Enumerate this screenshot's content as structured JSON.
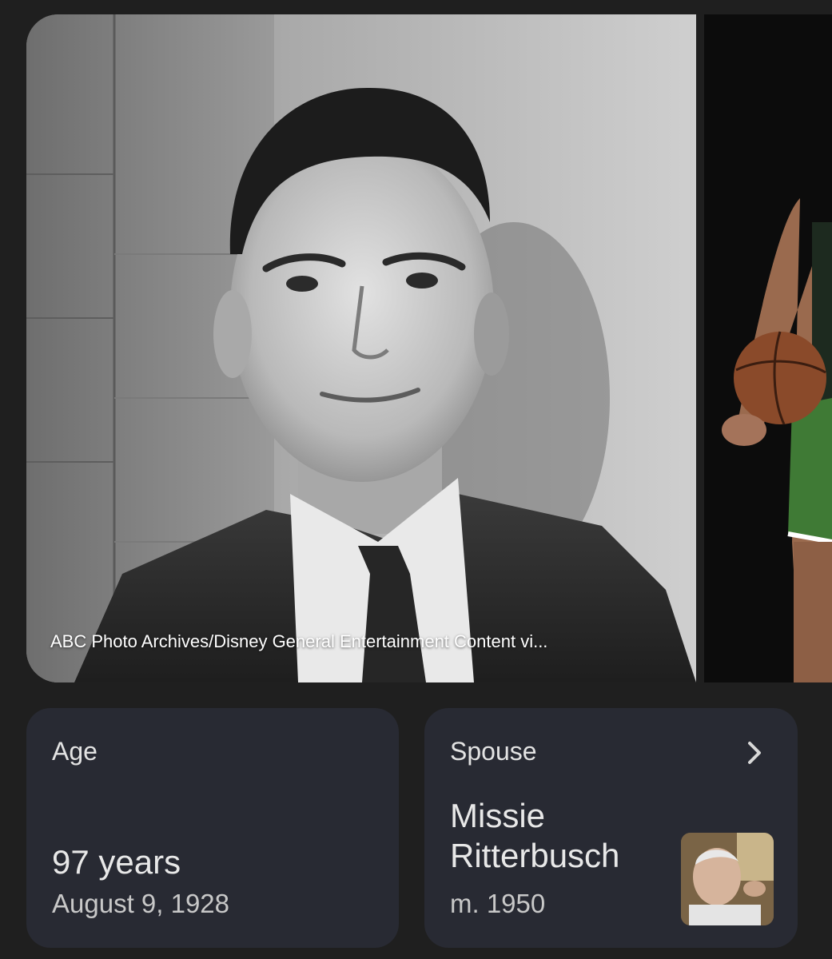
{
  "images": {
    "main_photo_caption": "ABC Photo Archives/Disney General Entertainment Content vi...",
    "main_photo_alt": "portrait-photo",
    "second_photo_alt": "basketball-player-photo"
  },
  "cards": {
    "age": {
      "label": "Age",
      "value": "97 years",
      "sub": "August 9, 1928"
    },
    "spouse": {
      "label": "Spouse",
      "name_line1": "Missie",
      "name_line2": "Ritterbusch",
      "sub": "m. 1950",
      "chevron_icon": "chevron-right-icon"
    }
  },
  "colors": {
    "background": "#1f1f1f",
    "card": "#282a33",
    "text_primary": "#e8e8e8",
    "text_secondary": "#c8c8c8"
  }
}
